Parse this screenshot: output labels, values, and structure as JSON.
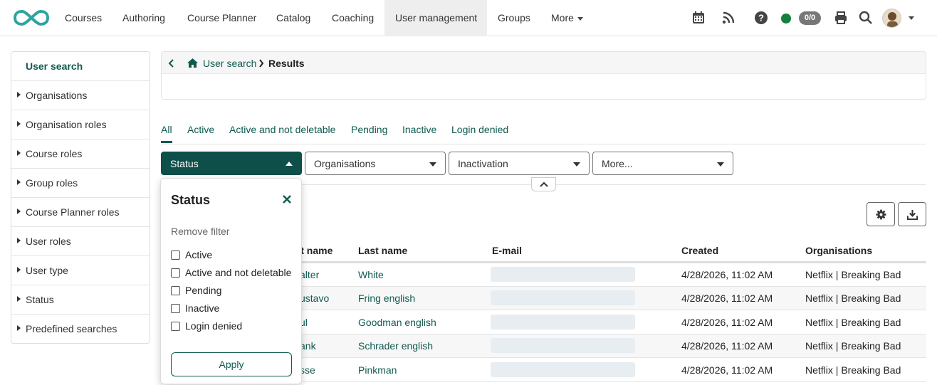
{
  "nav": {
    "items": [
      "Courses",
      "Authoring",
      "Course Planner",
      "Catalog",
      "Coaching",
      "User management",
      "Groups",
      "More"
    ],
    "active": "User management",
    "badge": "0/0"
  },
  "sidebar": {
    "title": "User search",
    "items": [
      "Organisations",
      "Organisation roles",
      "Course roles",
      "Group roles",
      "Course Planner roles",
      "User roles",
      "User type",
      "Status",
      "Predefined searches"
    ]
  },
  "breadcrumb": {
    "home": "User search",
    "current": "Results"
  },
  "tabs": [
    "All",
    "Active",
    "Active and not deletable",
    "Pending",
    "Inactive",
    "Login denied"
  ],
  "filters": [
    "Status",
    "Organisations",
    "Inactivation",
    "More..."
  ],
  "popup": {
    "title": "Status",
    "remove": "Remove filter",
    "options": [
      "Active",
      "Active and not deletable",
      "Pending",
      "Inactive",
      "Login denied"
    ],
    "apply": "Apply"
  },
  "table": {
    "headers": [
      "rst name",
      "Last name",
      "E-mail",
      "Created",
      "Organisations"
    ],
    "rows": [
      {
        "first": "alter",
        "last": "White",
        "created": "4/28/2026, 11:02 AM",
        "orgs": "Netflix | Breaking Bad"
      },
      {
        "first": "ustavo",
        "last": "Fring english",
        "created": "4/28/2026, 11:02 AM",
        "orgs": "Netflix | Breaking Bad"
      },
      {
        "first": "ul",
        "last": "Goodman english",
        "created": "4/28/2026, 11:02 AM",
        "orgs": "Netflix | Breaking Bad"
      },
      {
        "first": "ank",
        "last": "Schrader english",
        "created": "4/28/2026, 11:02 AM",
        "orgs": "Netflix | Breaking Bad"
      },
      {
        "first": "sse",
        "last": "Pinkman",
        "created": "4/28/2026, 11:02 AM",
        "orgs": "Netflix | Breaking Bad"
      }
    ]
  },
  "colors": {
    "accent": "#0f5a50",
    "active_filter": "#0f4f49",
    "online": "#14803c"
  },
  "icons": [
    "logo-infinity-icon",
    "calendar-icon",
    "rss-icon",
    "help-icon",
    "print-icon",
    "search-icon",
    "home-icon",
    "back-chevron-icon",
    "close-icon",
    "chevron-up-icon",
    "gear-icon",
    "download-icon"
  ]
}
